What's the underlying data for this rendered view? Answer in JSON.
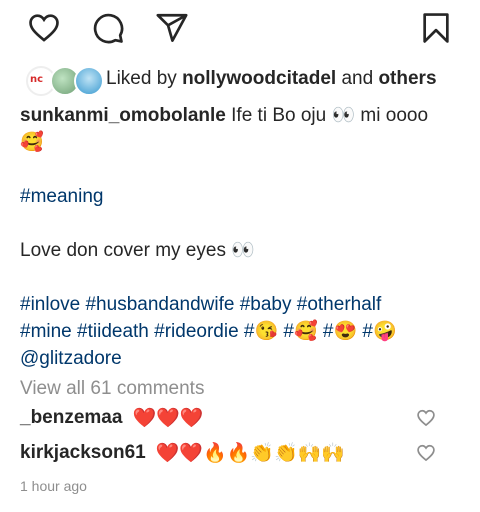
{
  "likes": {
    "prefix": "Liked by",
    "user": "nollywoodcitadel",
    "and": "and",
    "others": "others"
  },
  "caption": {
    "username": "sunkanmi_omobolanle",
    "line1": "Ife ti Bo oju 👀 mi oooo",
    "line2": "🥰",
    "meaning_tag": "#meaning",
    "line_love": "Love don cover my eyes 👀",
    "tags_line1": "#inlove #husbandandwife #baby #otherhalf",
    "tags_line2": "#mine #tiideath #rideordie #😘 #🥰 #😍 #🤪",
    "mention": "@glitzadore"
  },
  "view_all": "View all 61 comments",
  "comments": [
    {
      "username": "_benzemaa",
      "text": "❤️❤️❤️"
    },
    {
      "username": "kirkjackson61",
      "text": "❤️❤️🔥🔥👏👏🙌🙌"
    }
  ],
  "time": "1 hour ago",
  "icons": {
    "like": "heart-icon",
    "comment": "comment-bubble-icon",
    "share": "paper-plane-icon",
    "save": "bookmark-icon"
  }
}
